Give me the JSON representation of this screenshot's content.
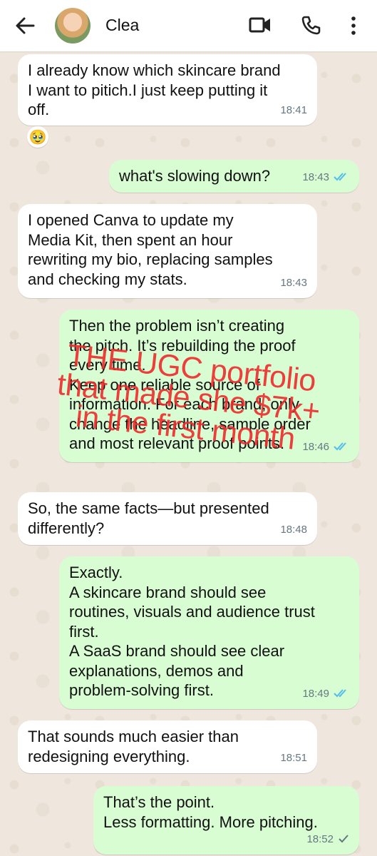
{
  "contact": {
    "name": "Clea"
  },
  "header": {
    "back_icon": "back-arrow-icon",
    "video_icon": "video-call-icon",
    "call_icon": "phone-icon",
    "menu_icon": "more-vert-icon"
  },
  "messages": [
    {
      "side": "in",
      "text": "I already know which skincare brand\nI want to pitich.I just keep putting it\noff.",
      "time": "18:41",
      "reaction": "🥹"
    },
    {
      "side": "out",
      "text": "what's slowing down?",
      "time": "18:43",
      "status": "read"
    },
    {
      "side": "in",
      "text": "I opened Canva to update my\nMedia Kit, then spent an hour\nrewriting my bio, replacing samples\nand checking my stats.",
      "time": "18:43"
    },
    {
      "side": "out",
      "text": "Then the problem isn’t creating\nthe pitch. It’s rebuilding the proof\nevery time.\nKeep one reliable source of\ninformation. For each brand, only\nchange the headline, sample order\nand most relevant proof points.",
      "time": "18:46",
      "status": "read"
    },
    {
      "side": "in",
      "text": "So, the same facts—but presented\ndifferently?",
      "time": "18:48"
    },
    {
      "side": "out",
      "text": "Exactly.\nA skincare brand should see\nroutines, visuals and audience trust\nfirst.\nA SaaS brand should see clear\nexplanations, demos and\nproblem-solving first.",
      "time": "18:49",
      "status": "read"
    },
    {
      "side": "in",
      "text": "That sounds much easier than\nredesigning everything.",
      "time": "18:51"
    },
    {
      "side": "out",
      "text": "That’s the point.\nLess formatting. More pitching.",
      "time": "18:52",
      "status": "sent"
    }
  ],
  "overlay_text": "THE UGC portfolio\nthat made she $7k+\nin the first month",
  "colors": {
    "incoming_bubble": "#ffffff",
    "outgoing_bubble": "#d9fdd3",
    "read_tick": "#53bdeb",
    "overlay": "#ef2b2b"
  }
}
